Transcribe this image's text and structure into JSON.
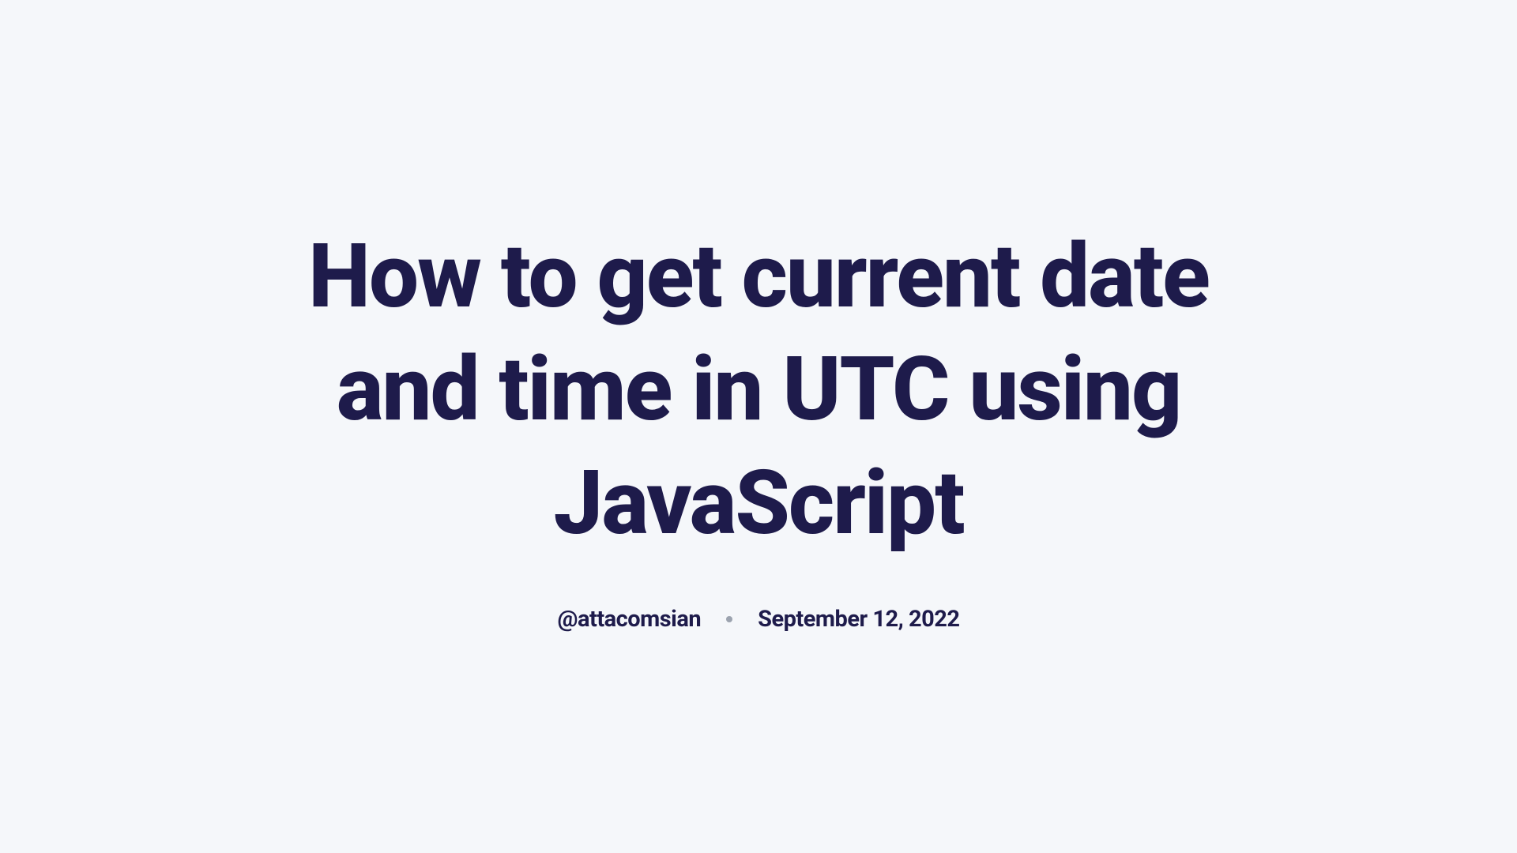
{
  "title": "How to get current date and time in UTC using JavaScript",
  "author": "@attacomsian",
  "date": "September 12, 2022"
}
